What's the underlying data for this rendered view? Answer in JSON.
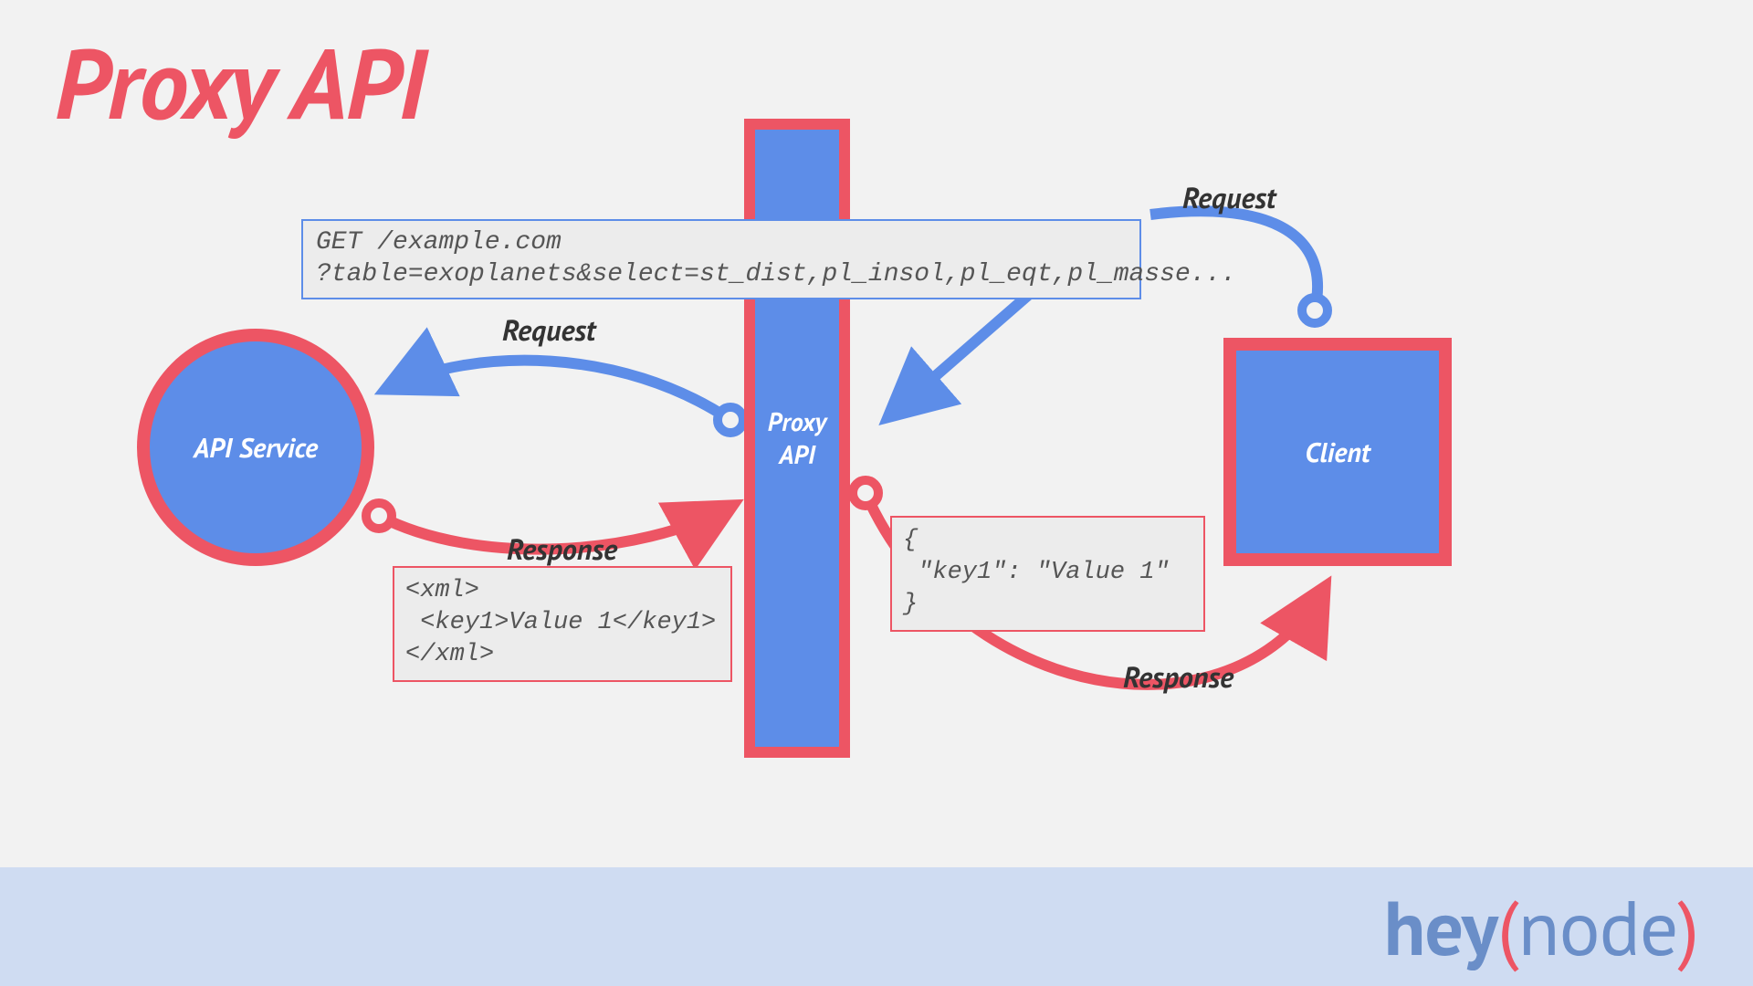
{
  "title": "Proxy API",
  "nodes": {
    "api_service": "API Service",
    "proxy": "Proxy\nAPI",
    "client": "Client"
  },
  "flows": {
    "request_left": "Request",
    "response_left": "Response",
    "request_right": "Request",
    "response_right": "Response"
  },
  "code": {
    "request": "GET /example.com\n?table=exoplanets&select=st_dist,pl_insol,pl_eqt,pl_masse...",
    "xml": "<xml>\n <key1>Value 1</key1>\n</xml>",
    "json": "{\n \"key1\": \"Value 1\"\n}"
  },
  "logo": {
    "hey": "hey",
    "open": "(",
    "node": "node",
    "close": ")"
  },
  "colors": {
    "red": "#ed5564",
    "blue": "#5d8de8"
  }
}
